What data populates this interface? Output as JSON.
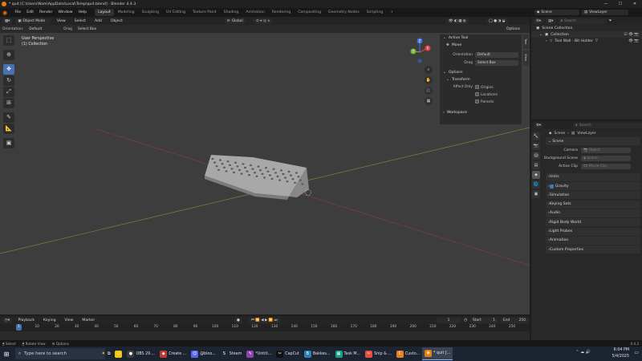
{
  "window": {
    "title": "* quit [C:\\Users\\Nam\\AppData\\Local\\Temp\\quit.blend] - Blender 4.4.3",
    "min": "—",
    "max": "☐",
    "close": "✕"
  },
  "menus": [
    "File",
    "Edit",
    "Render",
    "Window",
    "Help"
  ],
  "workspaces": [
    "Layout",
    "Modeling",
    "Sculpting",
    "UV Editing",
    "Texture Paint",
    "Shading",
    "Animation",
    "Rendering",
    "Compositing",
    "Geometry Nodes",
    "Scripting",
    "+"
  ],
  "active_workspace": "Layout",
  "scene_selector": {
    "scene": "Scene",
    "view_layer": "ViewLayer"
  },
  "viewport_header": {
    "mode": "Object Mode",
    "menus": [
      "View",
      "Select",
      "Add",
      "Object"
    ],
    "transform_orientation": "Global",
    "options_label": "Options"
  },
  "tool_header": {
    "orientation_label": "Orientation:",
    "orientation_value": "Default",
    "drag_label": "Drag",
    "drag_value": "Select Box"
  },
  "viewport_info": {
    "line1": "User Perspective",
    "line2": "(1) Collection"
  },
  "toolbar_icons": [
    "select-box-icon",
    "cursor-icon",
    "move-icon",
    "rotate-icon",
    "scale-icon",
    "transform-icon",
    "annotate-icon",
    "measure-icon",
    "add-cube-icon"
  ],
  "gizmo": {
    "x": "X",
    "y": "Y",
    "z": "Z"
  },
  "n_panel": {
    "tabs": [
      "Tool",
      "View"
    ],
    "active_tool_title": "Active Tool",
    "tool_name": "Move",
    "orientation_label": "Orientation",
    "orientation_value": "Default",
    "drag_label": "Drag",
    "drag_value": "Select Box",
    "options_title": "Options",
    "transform_title": "Transform",
    "affect_only_label": "Affect Only",
    "affect_options": [
      "Origins",
      "Locations",
      "Parents"
    ],
    "workspace_title": "Workspace"
  },
  "timeline": {
    "menus": [
      "Playback",
      "Keying",
      "View",
      "Marker"
    ],
    "current_frame": "1",
    "start_label": "Start",
    "start": "1",
    "end_label": "End",
    "end": "250",
    "ruler": [
      1,
      10,
      20,
      30,
      40,
      50,
      60,
      70,
      80,
      90,
      100,
      110,
      120,
      130,
      140,
      150,
      160,
      170,
      180,
      190,
      200,
      210,
      220,
      230,
      240,
      250
    ],
    "ruler_max": 250
  },
  "statusbar": {
    "items": [
      "Select",
      "Rotate View",
      "Options"
    ],
    "version": "4.4.3"
  },
  "outliner": {
    "search_placeholder": "Search",
    "root": "Scene Collection",
    "collection": "Collection",
    "object": "Tool Wall - Bit Holder"
  },
  "properties": {
    "search_placeholder": "Search",
    "breadcrumb_scene": "Scene",
    "breadcrumb_layer": "ViewLayer",
    "scene_section": "Scene",
    "camera_label": "Camera",
    "camera_value": "Object",
    "background_label": "Background Scene",
    "background_value": "Scene",
    "clip_label": "Active Clip",
    "clip_value": "Movie Clip",
    "sections": [
      "Units",
      "Gravity",
      "Simulation",
      "Keying Sets",
      "Audio",
      "Rigid Body World",
      "Light Probes",
      "Animation",
      "Custom Properties"
    ]
  },
  "taskbar": {
    "search_placeholder": "Type here to search",
    "items": [
      {
        "label": "OBS 29....",
        "color": "#3b3b3b",
        "glyph": "●"
      },
      {
        "label": "Create ...",
        "color": "#c0392b",
        "glyph": "◆"
      },
      {
        "label": "@bloo...",
        "color": "#5865f2",
        "glyph": "☺"
      },
      {
        "label": "Steam",
        "color": "#1b2838",
        "glyph": "S"
      },
      {
        "label": "*Untitl...",
        "color": "#8e44ad",
        "glyph": "✎"
      },
      {
        "label": "CapCut",
        "color": "#111111",
        "glyph": "✂"
      },
      {
        "label": "Bakkes...",
        "color": "#2980b9",
        "glyph": "B"
      },
      {
        "label": "Task M...",
        "color": "#16a085",
        "glyph": "▦"
      },
      {
        "label": "Snip & ...",
        "color": "#e74c3c",
        "glyph": "✂"
      },
      {
        "label": "Custo...",
        "color": "#e67e22",
        "glyph": "C"
      },
      {
        "label": "* quit [...",
        "color": "#e87d0d",
        "glyph": "◉"
      }
    ],
    "time": "6:04 PM",
    "date": "5/4/2025"
  }
}
